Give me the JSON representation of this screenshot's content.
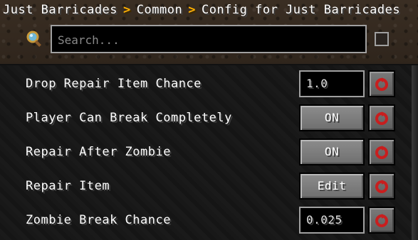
{
  "breadcrumb": {
    "items": [
      "Just Barricades",
      "Common",
      "Config for Just Barricades"
    ],
    "separator": ">"
  },
  "search": {
    "placeholder": "Search...",
    "value": "",
    "icon": "magnifier-icon"
  },
  "rows": [
    {
      "label": "Drop Repair Item Chance",
      "control": "text",
      "value": "1.0"
    },
    {
      "label": "Player Can Break Completely",
      "control": "button",
      "value": "ON"
    },
    {
      "label": "Repair After Zombie",
      "control": "button",
      "value": "ON"
    },
    {
      "label": "Repair Item",
      "control": "button",
      "value": "Edit"
    },
    {
      "label": "Zombie Break Chance",
      "control": "text",
      "value": "0.025"
    }
  ],
  "colors": {
    "breadcrumb_separator": "#ffb000",
    "reset_icon": "#c81e1e"
  }
}
